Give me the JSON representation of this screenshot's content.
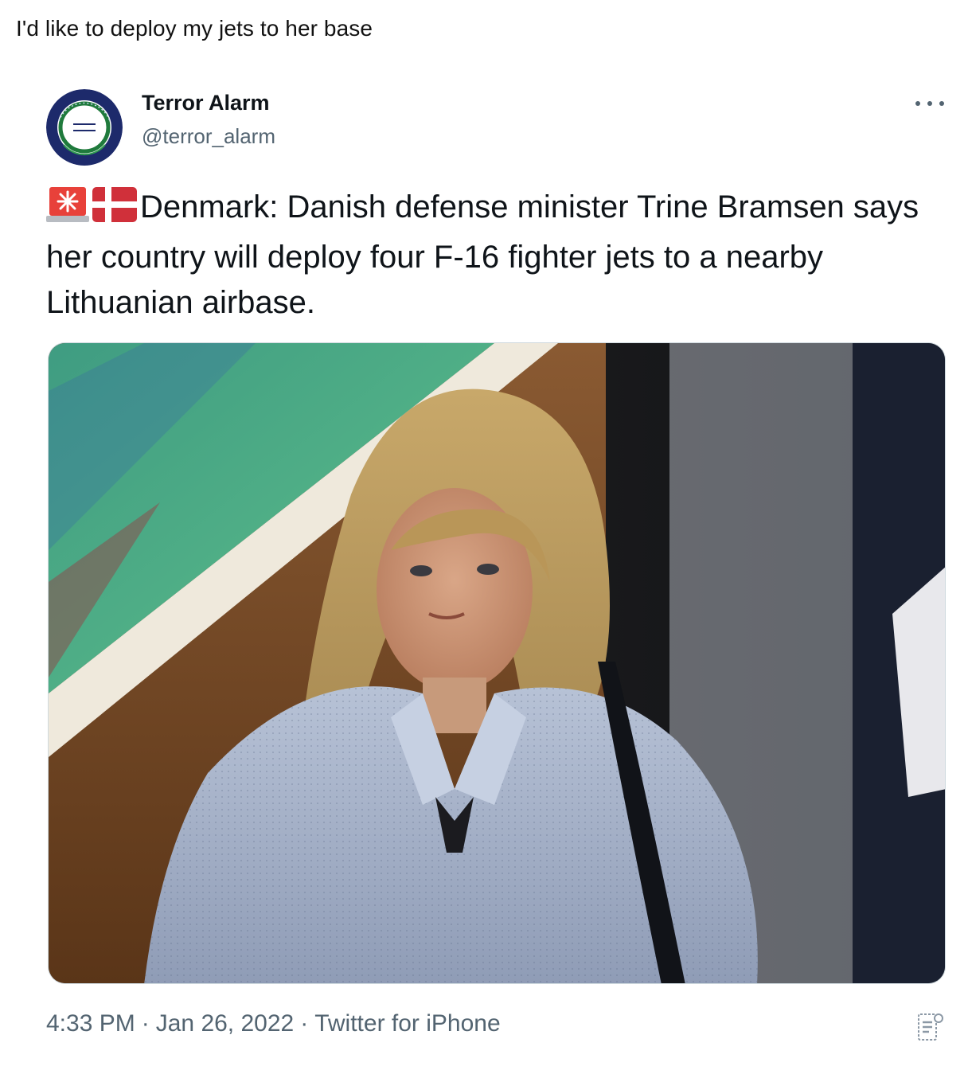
{
  "caption": "I'd like to deploy my jets to her base",
  "tweet": {
    "author": {
      "name": "Terror Alarm",
      "handle": "@terror_alarm",
      "avatar_icon": "terror-alarm-seal-logo",
      "avatar_text": [
        "TERROR ALARM",
        "TERROR",
        "ALARM"
      ]
    },
    "more_icon": "more-options-icon",
    "emoji": [
      "rotating-light-icon",
      "denmark-flag-icon"
    ],
    "text": "Denmark: Danish defense minister Trine Bramsen says her country will deploy four F-16 fighter jets to a nearby Lithuanian airbase.",
    "media": {
      "type": "photo"
    },
    "meta": {
      "time": "4:33 PM",
      "date": "Jan 26, 2022",
      "source": "Twitter for iPhone",
      "separator": "·"
    },
    "analytics_icon": "tweet-analytics-icon"
  },
  "colors": {
    "primary_text": "#0f1419",
    "secondary_text": "#536471",
    "border": "#cfd9de"
  }
}
